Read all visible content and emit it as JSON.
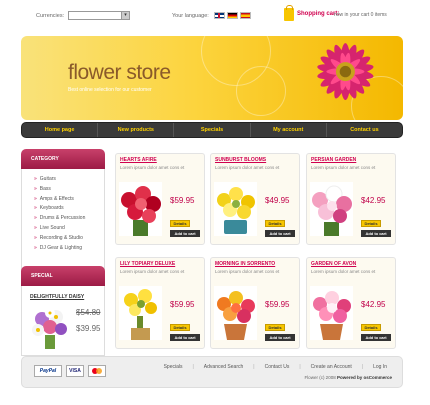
{
  "topbar": {
    "currencies_label": "Currencies:",
    "currency_value": "",
    "language_label": "Your language:",
    "cart_title": "Shopping cart:",
    "cart_text": "now in your cart 0 items"
  },
  "banner": {
    "logo": "flower store",
    "tagline": "Best online selection for our customer"
  },
  "nav": [
    "Home page",
    "New products",
    "Specials",
    "My account",
    "Contact us"
  ],
  "sidebar": {
    "category_title": "CATEGORY",
    "categories": [
      "Guitars",
      "Bass",
      "Amps & Effects",
      "Keyboards",
      "Drums & Percussion",
      "Live Sound",
      "Recording & Studio",
      "DJ Gear & Lighting"
    ],
    "special_title": "SPECIAL",
    "special_name": "DELIGHTFULLY DAISY",
    "special_old_price": "$54.80",
    "special_new_price": "$39.95"
  },
  "products": [
    {
      "title": "HEARTS AFIRE",
      "desc": "Lorem ipsum dolor amet cons et",
      "price": "$59.95"
    },
    {
      "title": "SUNBURST BLOOMS",
      "desc": "Lorem ipsum dolor amet cons et",
      "price": "$49.95"
    },
    {
      "title": "PERSIAN GARDEN",
      "desc": "Lorem ipsum dolor amet cons et",
      "price": "$42.95"
    },
    {
      "title": "LILY TOPIARY DELUXE",
      "desc": "Lorem ipsum dolor amet cons et",
      "price": "$59.95"
    },
    {
      "title": "MORNING IN SORRENTO",
      "desc": "Lorem ipsum dolor amet cons et",
      "price": "$59.95"
    },
    {
      "title": "GARDEN OF AVON",
      "desc": "Lorem ipsum dolor amet cons et",
      "price": "$42.95"
    }
  ],
  "buttons": {
    "details": "Details",
    "add_to_cart": "Add to cart"
  },
  "footer": {
    "links": [
      "Specials",
      "Advanced Search",
      "Contact Us",
      "Create an Account",
      "Log In"
    ],
    "copyright": "Flower (c) 2008",
    "powered": "Powered by osCommerce",
    "paypal": "PayPal",
    "visa": "VISA"
  },
  "colors": {
    "accent": "#d0004f",
    "banner": "#fcd43e",
    "nav": "#3a3a3a"
  }
}
